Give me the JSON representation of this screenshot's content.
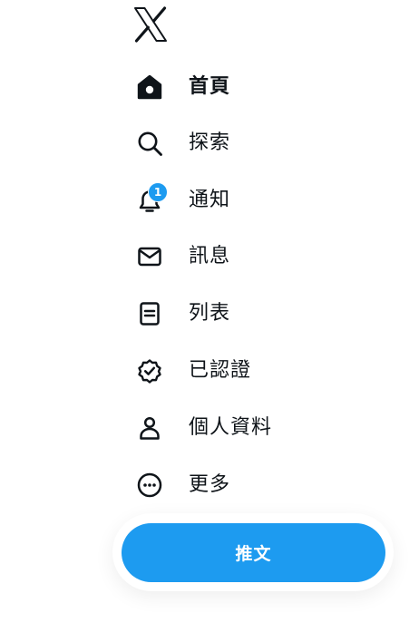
{
  "logo": {
    "icon": "x-logo-icon"
  },
  "nav": {
    "items": [
      {
        "id": "home",
        "label": "首頁",
        "icon": "home-icon",
        "active": true
      },
      {
        "id": "explore",
        "label": "探索",
        "icon": "search-icon",
        "active": false
      },
      {
        "id": "notifications",
        "label": "通知",
        "icon": "bell-icon",
        "active": false,
        "badge": "1"
      },
      {
        "id": "messages",
        "label": "訊息",
        "icon": "envelope-icon",
        "active": false
      },
      {
        "id": "lists",
        "label": "列表",
        "icon": "list-icon",
        "active": false
      },
      {
        "id": "verified",
        "label": "已認證",
        "icon": "verified-badge-icon",
        "active": false
      },
      {
        "id": "profile",
        "label": "個人資料",
        "icon": "person-icon",
        "active": false
      },
      {
        "id": "more",
        "label": "更多",
        "icon": "more-circle-icon",
        "active": false
      }
    ]
  },
  "tweet_button": {
    "label": "推文"
  },
  "colors": {
    "accent": "#1d9bf0",
    "text": "#0f1419",
    "background": "#ffffff"
  }
}
